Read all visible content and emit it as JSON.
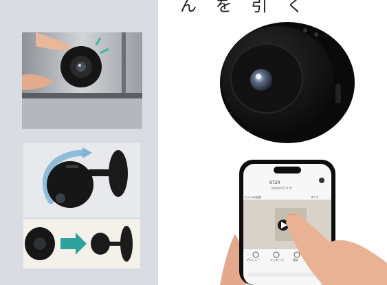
{
  "header_partial_text": "ん を 引 く",
  "phone_screen": {
    "time": "9720",
    "subtitle": "Visionカメラ",
    "left_label": "カメラの名前",
    "right_label": "すべて",
    "bottom_labels": [
      "プレビュー",
      "メッセージ",
      "設定"
    ]
  },
  "colors": {
    "left_panel_bg": "#d9dde3",
    "camera_body": "#151515",
    "mount_blue": "#2b7fbf",
    "teal_arrow": "#2ea29b"
  }
}
